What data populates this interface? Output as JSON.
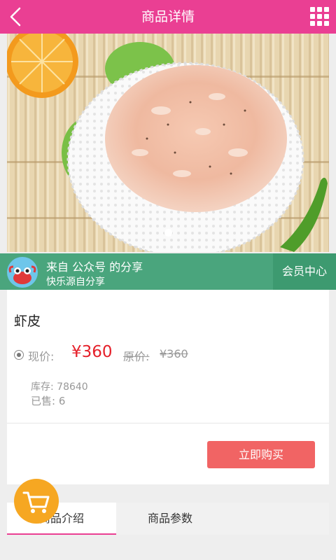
{
  "header": {
    "title": "商品详情",
    "back_icon": "chevron-left-icon",
    "menu_icon": "grid-icon",
    "color": "#ea3f93"
  },
  "gallery": {
    "image": "dried-shrimp-photo",
    "page_count": 1,
    "active_page": 1
  },
  "share": {
    "line1": "来自 公众号 的分享",
    "line2": "快乐源自分享",
    "member_center": "会员中心",
    "color": "#4aa57d"
  },
  "product": {
    "name": "虾皮",
    "current_label": "现价:",
    "current_price": "¥360",
    "original_label": "原价:",
    "original_price": "¥360",
    "stock": "库存: 78640",
    "sold_label": "已售:",
    "sold_value": "6",
    "buy_button": "立即购买",
    "price_color": "#e5202a",
    "button_color": "#f16464"
  },
  "tabs": [
    {
      "label": "商品介绍",
      "active": true
    },
    {
      "label": "商品参数",
      "active": false
    }
  ],
  "cart": {
    "icon": "cart-icon",
    "color": "#f6a722"
  }
}
